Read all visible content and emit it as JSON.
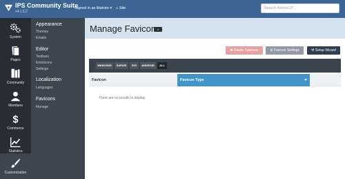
{
  "topbar": {
    "brand": "IPS Community Suite",
    "version": "v4.1.5.2",
    "signed_in": "Signed in as Makoto ▾",
    "site_link": "⌂ Site",
    "search_placeholder": "Search AdminCP..."
  },
  "nav_primary": [
    {
      "label": "System",
      "icon": "gears-icon"
    },
    {
      "label": "Pages",
      "icon": "pages-icon"
    },
    {
      "label": "Community",
      "icon": "community-icon"
    },
    {
      "label": "Members",
      "icon": "members-icon"
    },
    {
      "label": "Commerce",
      "icon": "dollar-icon"
    },
    {
      "label": "Statistics",
      "icon": "chart-icon"
    },
    {
      "label": "Customization",
      "icon": "brush-icon",
      "active": true
    }
  ],
  "nav_secondary": {
    "sections": [
      {
        "title": "Appearance",
        "links": [
          "Themes",
          "Emails"
        ]
      },
      {
        "title": "Editor",
        "links": [
          "Toolbars",
          "Emoticons",
          "Settings"
        ]
      },
      {
        "title": "Localization",
        "links": [
          "Languages"
        ]
      },
      {
        "title": "Favicons",
        "links": [
          "Manage"
        ]
      }
    ]
  },
  "page": {
    "title": "Manage Favicons",
    "badge": "«",
    "buttons": {
      "delete": "✖ Delete Favicons",
      "settings": "⚙ Favicon Settings",
      "wizard": "⚒ Setup Wizard"
    },
    "filters": [
      "WINDOWS",
      "SAFARI",
      "IOS",
      "ANDROID",
      "ALL"
    ],
    "active_filter": "ALL",
    "columns": [
      "Favicon",
      "Favicon Type"
    ],
    "empty_message": "There are no results to display."
  },
  "colors": {
    "topbar": "#3d6594",
    "nav_primary": "#272d34",
    "nav_secondary": "#3c4550",
    "active_column": "#4393cb",
    "delete_button": "#e6a1a3"
  }
}
